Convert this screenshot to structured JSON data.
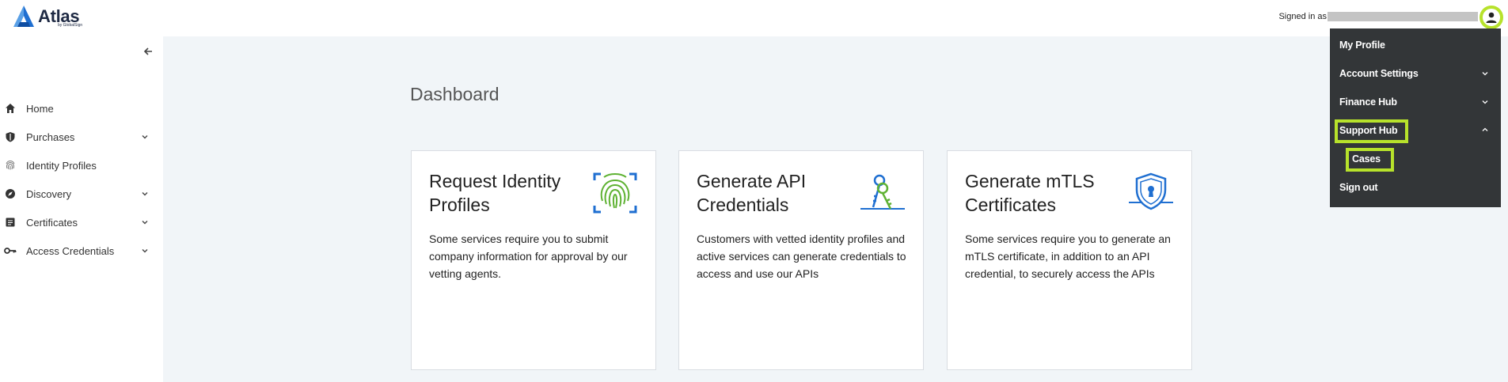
{
  "header": {
    "logo_text": "Atlas",
    "logo_subtext": "by GlobalSign",
    "signed_in_label": "Signed in as"
  },
  "sidebar": {
    "items": [
      {
        "label": "Home",
        "icon": "home-icon",
        "has_chevron": false
      },
      {
        "label": "Purchases",
        "icon": "shield-icon",
        "has_chevron": true
      },
      {
        "label": "Identity Profiles",
        "icon": "fingerprint-icon",
        "has_chevron": false
      },
      {
        "label": "Discovery",
        "icon": "compass-icon",
        "has_chevron": true
      },
      {
        "label": "Certificates",
        "icon": "certificate-icon",
        "has_chevron": true
      },
      {
        "label": "Access Credentials",
        "icon": "key-icon",
        "has_chevron": true
      }
    ]
  },
  "main": {
    "title": "Dashboard",
    "cards": [
      {
        "title": "Request Identity Profiles",
        "icon": "fingerprint-icon",
        "description": "Some services require you to submit company information for approval by our vetting agents."
      },
      {
        "title": "Generate API Credentials",
        "icon": "keys-icon",
        "description": "Customers with vetted identity profiles and active services can generate credentials to access and use our APIs"
      },
      {
        "title": "Generate mTLS Certificates",
        "icon": "shield-lock-icon",
        "description": "Some services require you to generate an mTLS certificate, in addition to an API credential, to securely access the APIs"
      }
    ]
  },
  "user_menu": {
    "items": [
      {
        "label": "My Profile",
        "chevron": "none"
      },
      {
        "label": "Account Settings",
        "chevron": "down"
      },
      {
        "label": "Finance Hub",
        "chevron": "down"
      },
      {
        "label": "Support Hub",
        "chevron": "up"
      },
      {
        "label": "Cases",
        "chevron": "none"
      },
      {
        "label": "Sign out",
        "chevron": "none"
      }
    ]
  },
  "colors": {
    "highlight": "#b7e22b",
    "menu_bg": "#333638",
    "main_bg": "#f1f5f8",
    "brand_blue": "#1f6fd1"
  }
}
